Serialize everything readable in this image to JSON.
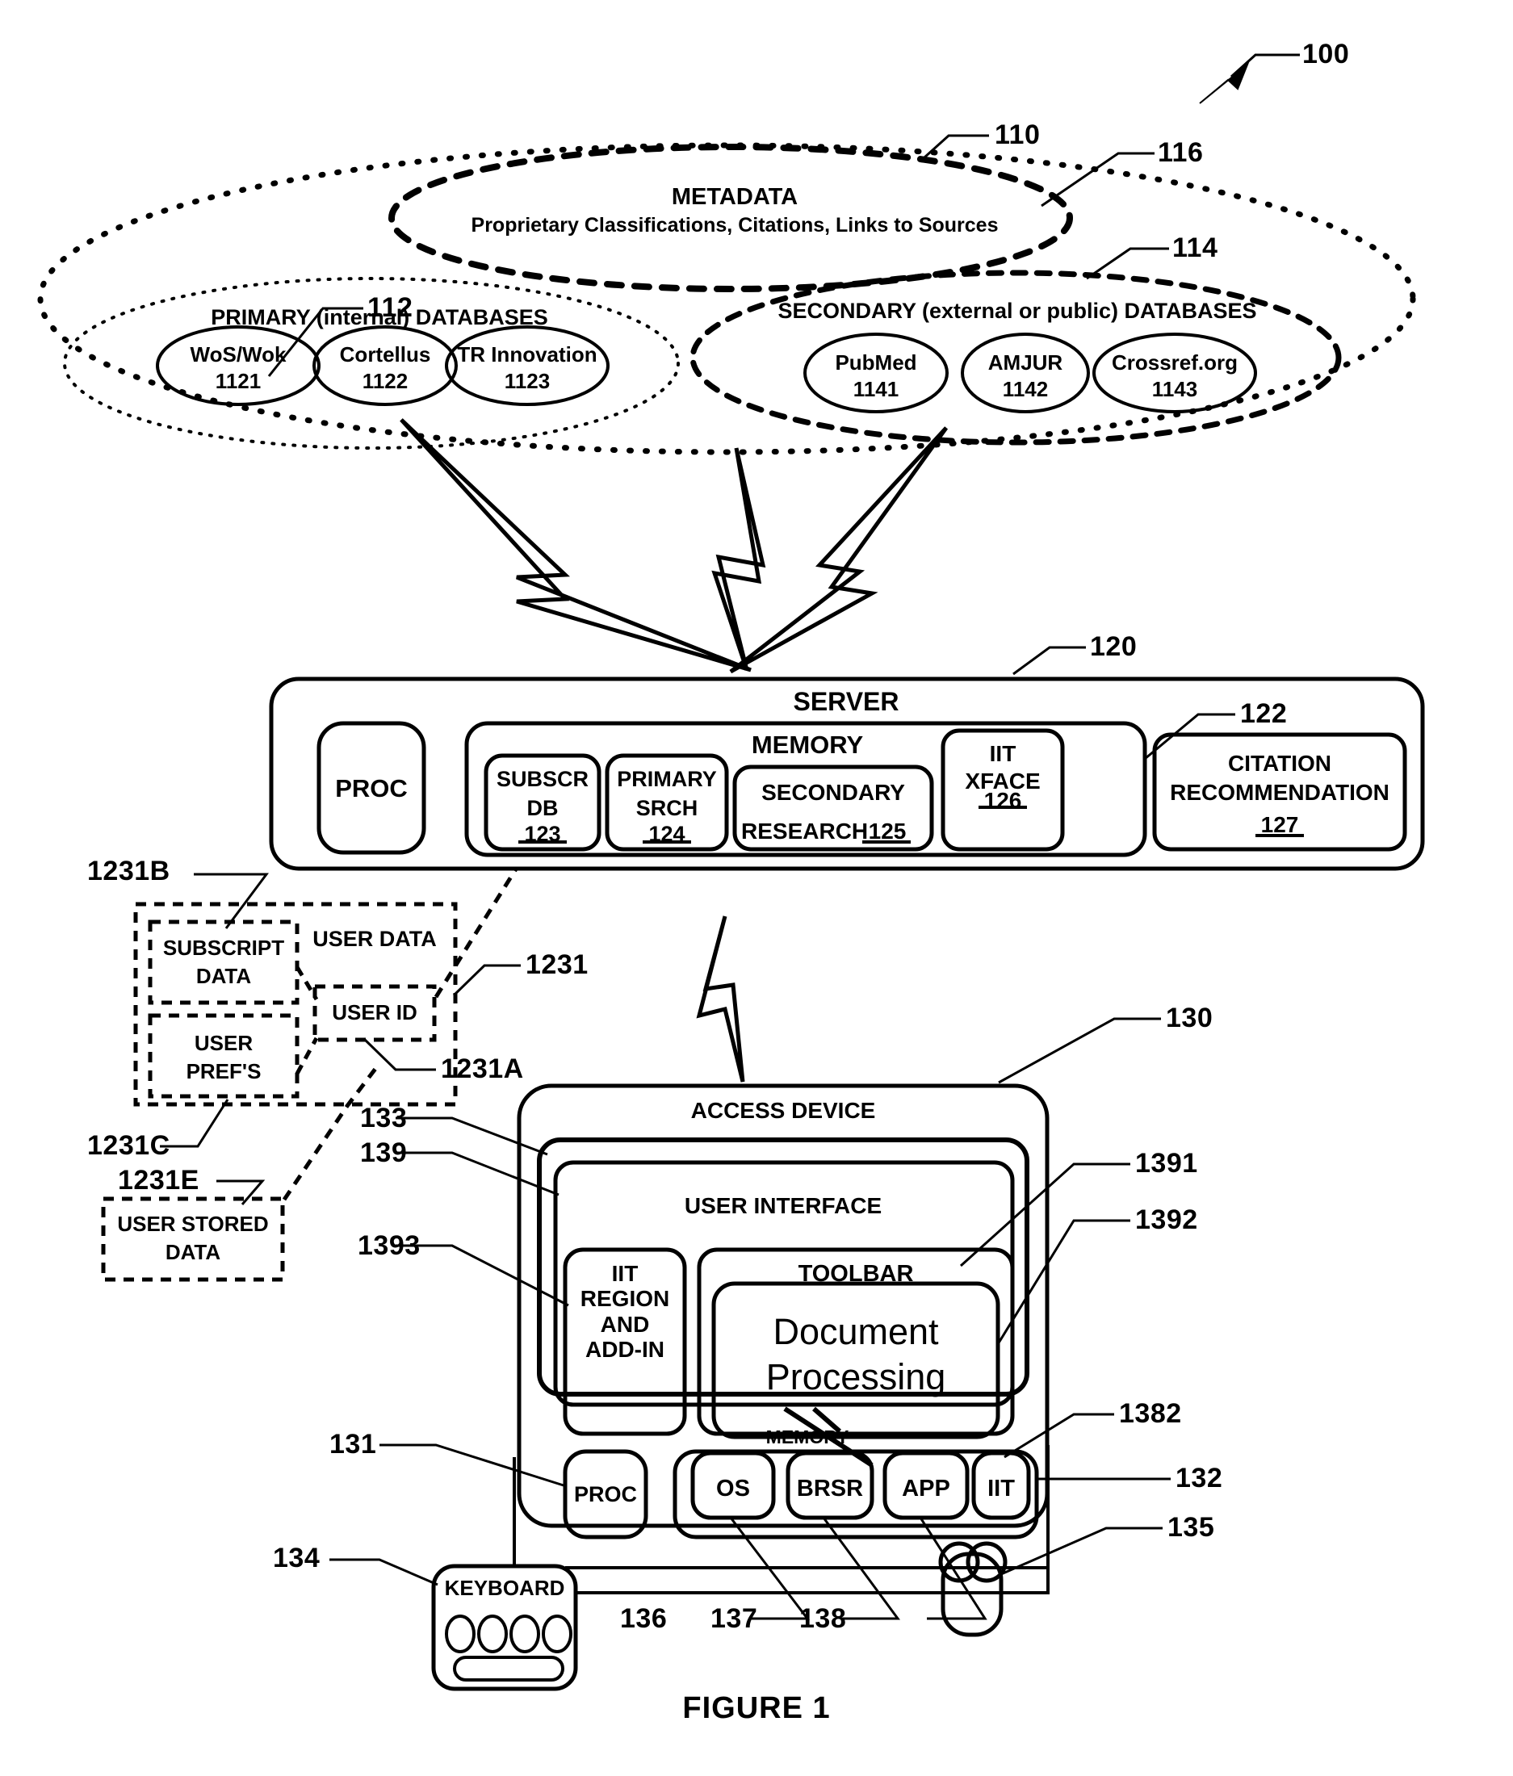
{
  "figure": {
    "caption": "FIGURE 1",
    "system_ref": "100"
  },
  "cloud": {
    "ref": "110",
    "metadata": {
      "ref": "116",
      "title": "METADATA",
      "subtitle": "Proprietary Classifications, Citations, Links to Sources"
    },
    "primary": {
      "ref": "112",
      "title": "PRIMARY (internal) DATABASES",
      "items": [
        {
          "name": "WoS/Wok",
          "ref": "1121"
        },
        {
          "name": "Cortellus",
          "ref": "1122"
        },
        {
          "name": "TR Innovation",
          "ref": "1123"
        }
      ]
    },
    "secondary": {
      "ref": "114",
      "title": "SECONDARY (external or public) DATABASES",
      "items": [
        {
          "name": "PubMed",
          "ref": "1141"
        },
        {
          "name": "AMJUR",
          "ref": "1142"
        },
        {
          "name": "Crossref.org",
          "ref": "1143"
        }
      ]
    }
  },
  "server": {
    "ref": "120",
    "title": "SERVER",
    "proc": "PROC",
    "memory": {
      "ref": "122",
      "title": "MEMORY",
      "modules": [
        {
          "line1": "SUBSCR",
          "line2": "DB",
          "ref": "123"
        },
        {
          "line1": "PRIMARY",
          "line2": "SRCH",
          "ref": "124"
        },
        {
          "line1": "SECONDARY",
          "line2": "RESEARCH",
          "ref": "125"
        },
        {
          "line1": "IIT",
          "line2": "XFACE",
          "ref": "126"
        }
      ]
    },
    "citation": {
      "line1": "CITATION",
      "line2": "RECOMMENDATION",
      "ref": "127"
    }
  },
  "user_data": {
    "title": "USER DATA",
    "ref": "1231",
    "subscript_data": {
      "line1": "SUBSCRIPT",
      "line2": "DATA",
      "ref": "1231B"
    },
    "user_prefs": {
      "line1": "USER",
      "line2": "PREF'S",
      "ref": "1231C"
    },
    "user_id": {
      "label": "USER ID",
      "ref": "1231A"
    },
    "user_stored": {
      "line1": "USER STORED",
      "line2": "DATA",
      "ref": "1231E"
    }
  },
  "access_device": {
    "ref": "130",
    "title": "ACCESS DEVICE",
    "display_ref": "133",
    "user_interface": {
      "ref": "139",
      "title": "USER INTERFACE",
      "iit_region": {
        "text": "IIT\nREGION\nAND\nADD-IN",
        "ref": "1393"
      },
      "toolbar": {
        "label": "TOOLBAR",
        "ref": "1391"
      },
      "document_processing": {
        "text": "Document\nProcessing",
        "ref": "1392"
      }
    },
    "proc": {
      "label": "PROC",
      "ref": "131"
    },
    "memory": {
      "label": "MEMORY",
      "ref": "132",
      "modules": [
        {
          "label": "OS",
          "ref": "136"
        },
        {
          "label": "BRSR",
          "ref": "137"
        },
        {
          "label": "APP",
          "ref": "138"
        },
        {
          "label": "IIT",
          "ref": "1382"
        }
      ]
    },
    "keyboard": {
      "label": "KEYBOARD",
      "ref": "134"
    },
    "mouse": {
      "ref": "135"
    }
  },
  "colors": {
    "stroke": "#000000",
    "background": "#ffffff"
  }
}
